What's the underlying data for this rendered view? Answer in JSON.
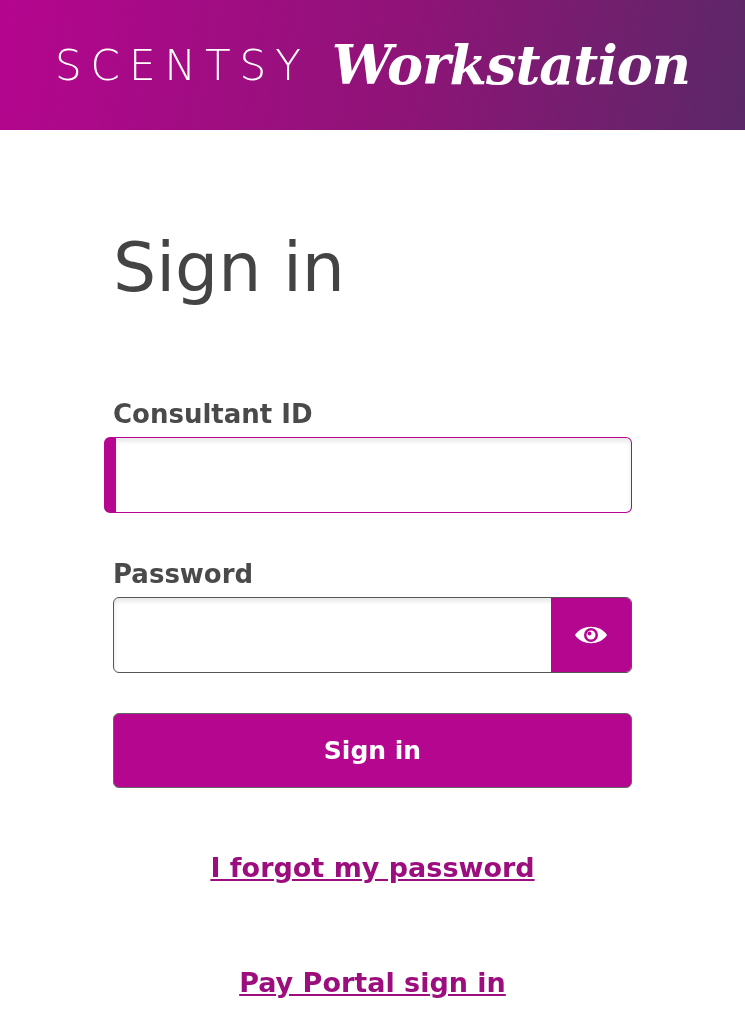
{
  "header": {
    "brand": "SCENTSY",
    "product": "Workstation"
  },
  "title": "Sign in",
  "fields": [
    {
      "label": "Consultant ID",
      "kind": "text",
      "focused": true
    },
    {
      "label": "Password",
      "kind": "password",
      "focused": false
    }
  ],
  "submit": "Sign in",
  "links": [
    "I forgot my password",
    "Pay Portal sign in"
  ]
}
